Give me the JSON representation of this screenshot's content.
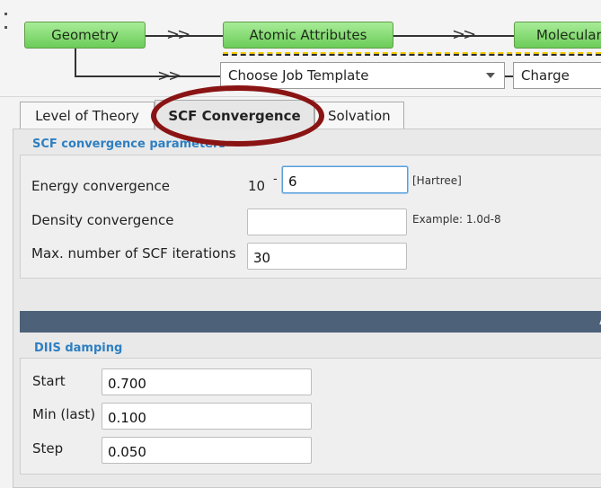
{
  "workflow": {
    "nodes": [
      "Geometry",
      "Atomic Attributes",
      "Molecular"
    ],
    "job_template_placeholder": "Choose Job Template",
    "charge_label": "Charge"
  },
  "tabs": [
    {
      "label": "Level of Theory",
      "active": false
    },
    {
      "label": "SCF Convergence",
      "active": true
    },
    {
      "label": "Solvation",
      "active": false
    }
  ],
  "scf": {
    "section_title": "SCF convergence parameters",
    "energy": {
      "label": "Energy convergence",
      "base": "10",
      "exp_sign": "-",
      "value": "6",
      "unit": "[Hartree]"
    },
    "density": {
      "label": "Density convergence",
      "value": "",
      "hint": "Example: 1.0d-8"
    },
    "max_iter": {
      "label": "Max. number of SCF iterations",
      "value": "30"
    }
  },
  "banner": {
    "text": "A"
  },
  "diis": {
    "section_title": "DIIS damping",
    "start": {
      "label": "Start",
      "value": "0.700"
    },
    "min_last": {
      "label": "Min (last)",
      "value": "0.100"
    },
    "step": {
      "label": "Step",
      "value": "0.050"
    }
  },
  "colors": {
    "node_green": "#7fd86a",
    "highlight_red": "#8a1414",
    "banner": "#4d6179",
    "section_blue": "#2e7fc2"
  }
}
